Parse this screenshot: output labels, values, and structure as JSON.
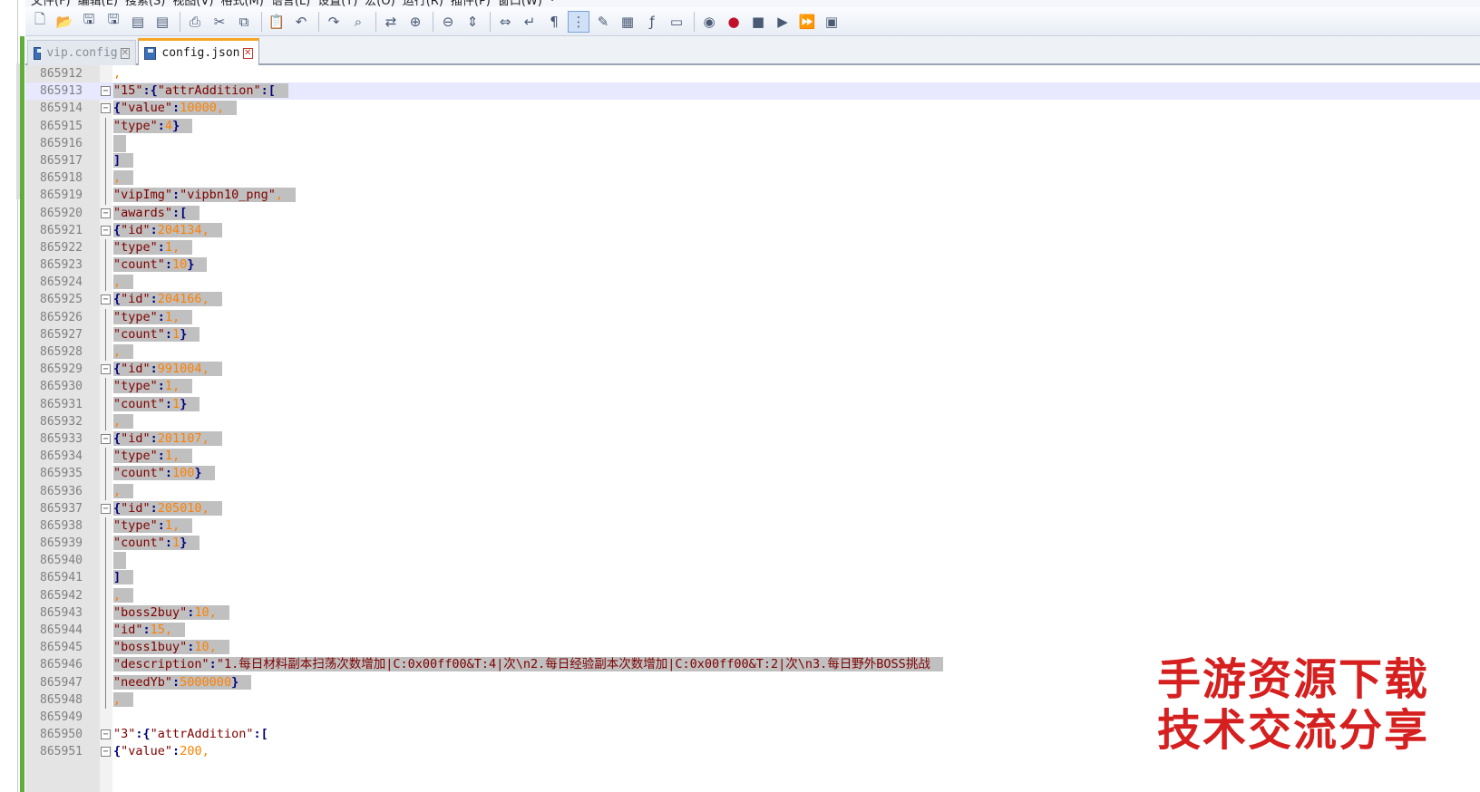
{
  "menu": [
    "文件(F)",
    "编辑(E)",
    "搜索(S)",
    "视图(V)",
    "格式(M)",
    "语言(L)",
    "设置(T)",
    "宏(O)",
    "运行(R)",
    "插件(P)",
    "窗口(W)",
    "?"
  ],
  "toolbar": {
    "buttons": [
      "new-file",
      "open-file",
      "save",
      "save-all",
      "close",
      "close-all",
      "print",
      "cut",
      "copy",
      "paste",
      "undo",
      "redo",
      "find",
      "replace",
      "zoom-in",
      "zoom-out",
      "sync-vertical",
      "sync-horizontal",
      "word-wrap",
      "show-all-chars",
      "indent-guide",
      "user-lang",
      "doc-map",
      "function-list",
      "folder-workspace",
      "monitoring",
      "macro-record",
      "macro-stop",
      "macro-play",
      "macro-run-multiple",
      "macro-save"
    ]
  },
  "tabs": [
    {
      "label": "vip.config",
      "active": false
    },
    {
      "label": "config.json",
      "active": true
    }
  ],
  "editor": {
    "current_line": "865913",
    "lines": [
      {
        "num": "865912",
        "text": ","
      },
      {
        "num": "865913",
        "text": "\"15\":{\"attrAddition\":["
      },
      {
        "num": "865914",
        "text": "{\"value\":10000,"
      },
      {
        "num": "865915",
        "text": "\"type\":4}"
      },
      {
        "num": "865916",
        "text": ""
      },
      {
        "num": "865917",
        "text": "]"
      },
      {
        "num": "865918",
        "text": ","
      },
      {
        "num": "865919",
        "text": "\"vipImg\":\"vipbn10_png\","
      },
      {
        "num": "865920",
        "text": "\"awards\":["
      },
      {
        "num": "865921",
        "text": "{\"id\":204134,"
      },
      {
        "num": "865922",
        "text": "\"type\":1,"
      },
      {
        "num": "865923",
        "text": "\"count\":10}"
      },
      {
        "num": "865924",
        "text": ","
      },
      {
        "num": "865925",
        "text": "{\"id\":204166,"
      },
      {
        "num": "865926",
        "text": "\"type\":1,"
      },
      {
        "num": "865927",
        "text": "\"count\":1}"
      },
      {
        "num": "865928",
        "text": ","
      },
      {
        "num": "865929",
        "text": "{\"id\":991004,"
      },
      {
        "num": "865930",
        "text": "\"type\":1,"
      },
      {
        "num": "865931",
        "text": "\"count\":1}"
      },
      {
        "num": "865932",
        "text": ","
      },
      {
        "num": "865933",
        "text": "{\"id\":201107,"
      },
      {
        "num": "865934",
        "text": "\"type\":1,"
      },
      {
        "num": "865935",
        "text": "\"count\":100}"
      },
      {
        "num": "865936",
        "text": ","
      },
      {
        "num": "865937",
        "text": "{\"id\":205010,"
      },
      {
        "num": "865938",
        "text": "\"type\":1,"
      },
      {
        "num": "865939",
        "text": "\"count\":1}"
      },
      {
        "num": "865940",
        "text": ""
      },
      {
        "num": "865941",
        "text": "]"
      },
      {
        "num": "865942",
        "text": ","
      },
      {
        "num": "865943",
        "text": "\"boss2buy\":10,"
      },
      {
        "num": "865944",
        "text": "\"id\":15,"
      },
      {
        "num": "865945",
        "text": "\"boss1buy\":10,"
      },
      {
        "num": "865946",
        "text": "\"description\":\"1.每日材料副本扫荡次数增加|C:0x00ff00&T:4|次\\n2.每日经验副本次数增加|C:0x00ff00&T:2|次\\n3.每日野外BOSS挑战"
      },
      {
        "num": "865947",
        "text": "\"needYb\":5000000}"
      },
      {
        "num": "865948",
        "text": ","
      },
      {
        "num": "865949",
        "text": ""
      },
      {
        "num": "865950",
        "text": "\"3\":{\"attrAddition\":["
      },
      {
        "num": "865951",
        "text": "{\"value\":200,"
      }
    ]
  },
  "watermark": [
    "手游资源下载",
    "技术交流分享"
  ]
}
